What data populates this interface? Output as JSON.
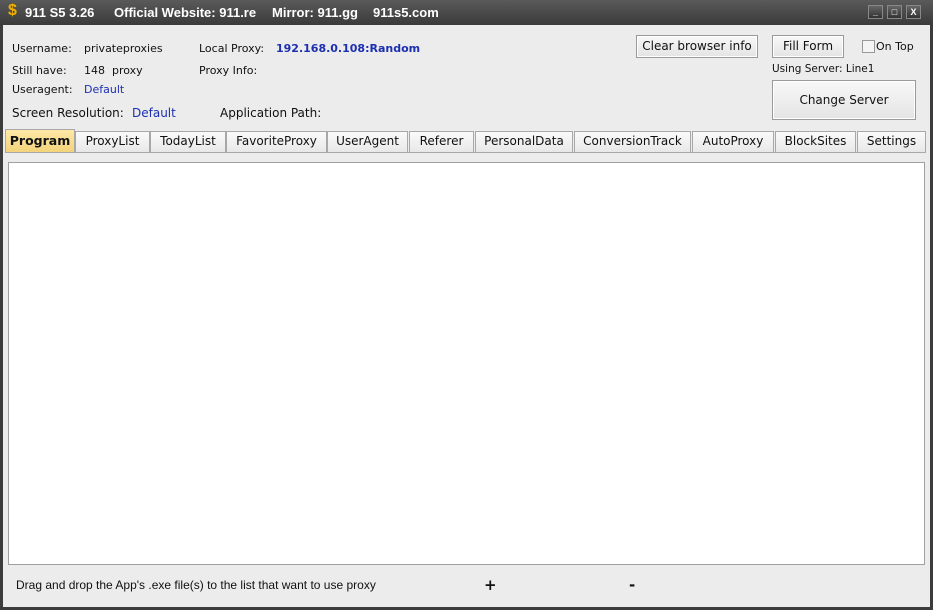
{
  "title": {
    "app": "911 S5 3.26",
    "website": "Official Website: 911.re",
    "mirror": "Mirror: 911.gg",
    "domain": "911s5.com",
    "icon": "dollar-icon"
  },
  "window_controls": {
    "minimize": "_",
    "maximize": "□",
    "close": "X"
  },
  "info": {
    "username_label": "Username:",
    "username": "privateproxies",
    "still_have_label": "Still have:",
    "still_have": "148  proxy",
    "useragent_label": "Useragent:",
    "useragent": "Default",
    "screen_resolution_label": "Screen Resolution:",
    "screen_resolution": "Default",
    "local_proxy_label": "Local Proxy:",
    "local_proxy": "192.168.0.108:Random",
    "proxy_info_label": "Proxy Info:",
    "application_path_label": "Application Path:",
    "using_server": "Using Server: Line1"
  },
  "buttons": {
    "clear_browser_info": "Clear browser info",
    "fill_form": "Fill Form",
    "change_server": "Change Server",
    "on_top": "On Top"
  },
  "on_top_checked": false,
  "tabs": [
    "Program",
    "ProxyList",
    "TodayList",
    "FavoriteProxy",
    "UserAgent",
    "Referer",
    "PersonalData",
    "ConversionTrack",
    "AutoProxy",
    "BlockSites",
    "Settings"
  ],
  "active_tab": "Program",
  "footer": {
    "hint": "Drag and drop the App's .exe file(s) to the list that want to use proxy",
    "add": "+",
    "remove": "-"
  }
}
